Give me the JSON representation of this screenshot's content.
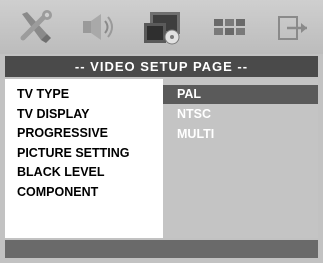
{
  "icons": [
    "tools-icon",
    "speaker-icon",
    "video-icon",
    "preferences-icon",
    "exit-icon"
  ],
  "title": "-- VIDEO SETUP PAGE --",
  "menu_items": [
    "TV TYPE",
    "TV DISPLAY",
    "PROGRESSIVE",
    "PICTURE SETTING",
    "BLACK LEVEL",
    "COMPONENT"
  ],
  "options": [
    "PAL",
    "NTSC",
    "MULTI"
  ],
  "selected_option": "PAL",
  "colors": {
    "background": "#c2c2c2",
    "title_bar": "#4a4a4a",
    "option_selected": "#5a5a5a",
    "option_panel": "#c4c4c4",
    "bottom_bar": "#6a6a6a"
  }
}
